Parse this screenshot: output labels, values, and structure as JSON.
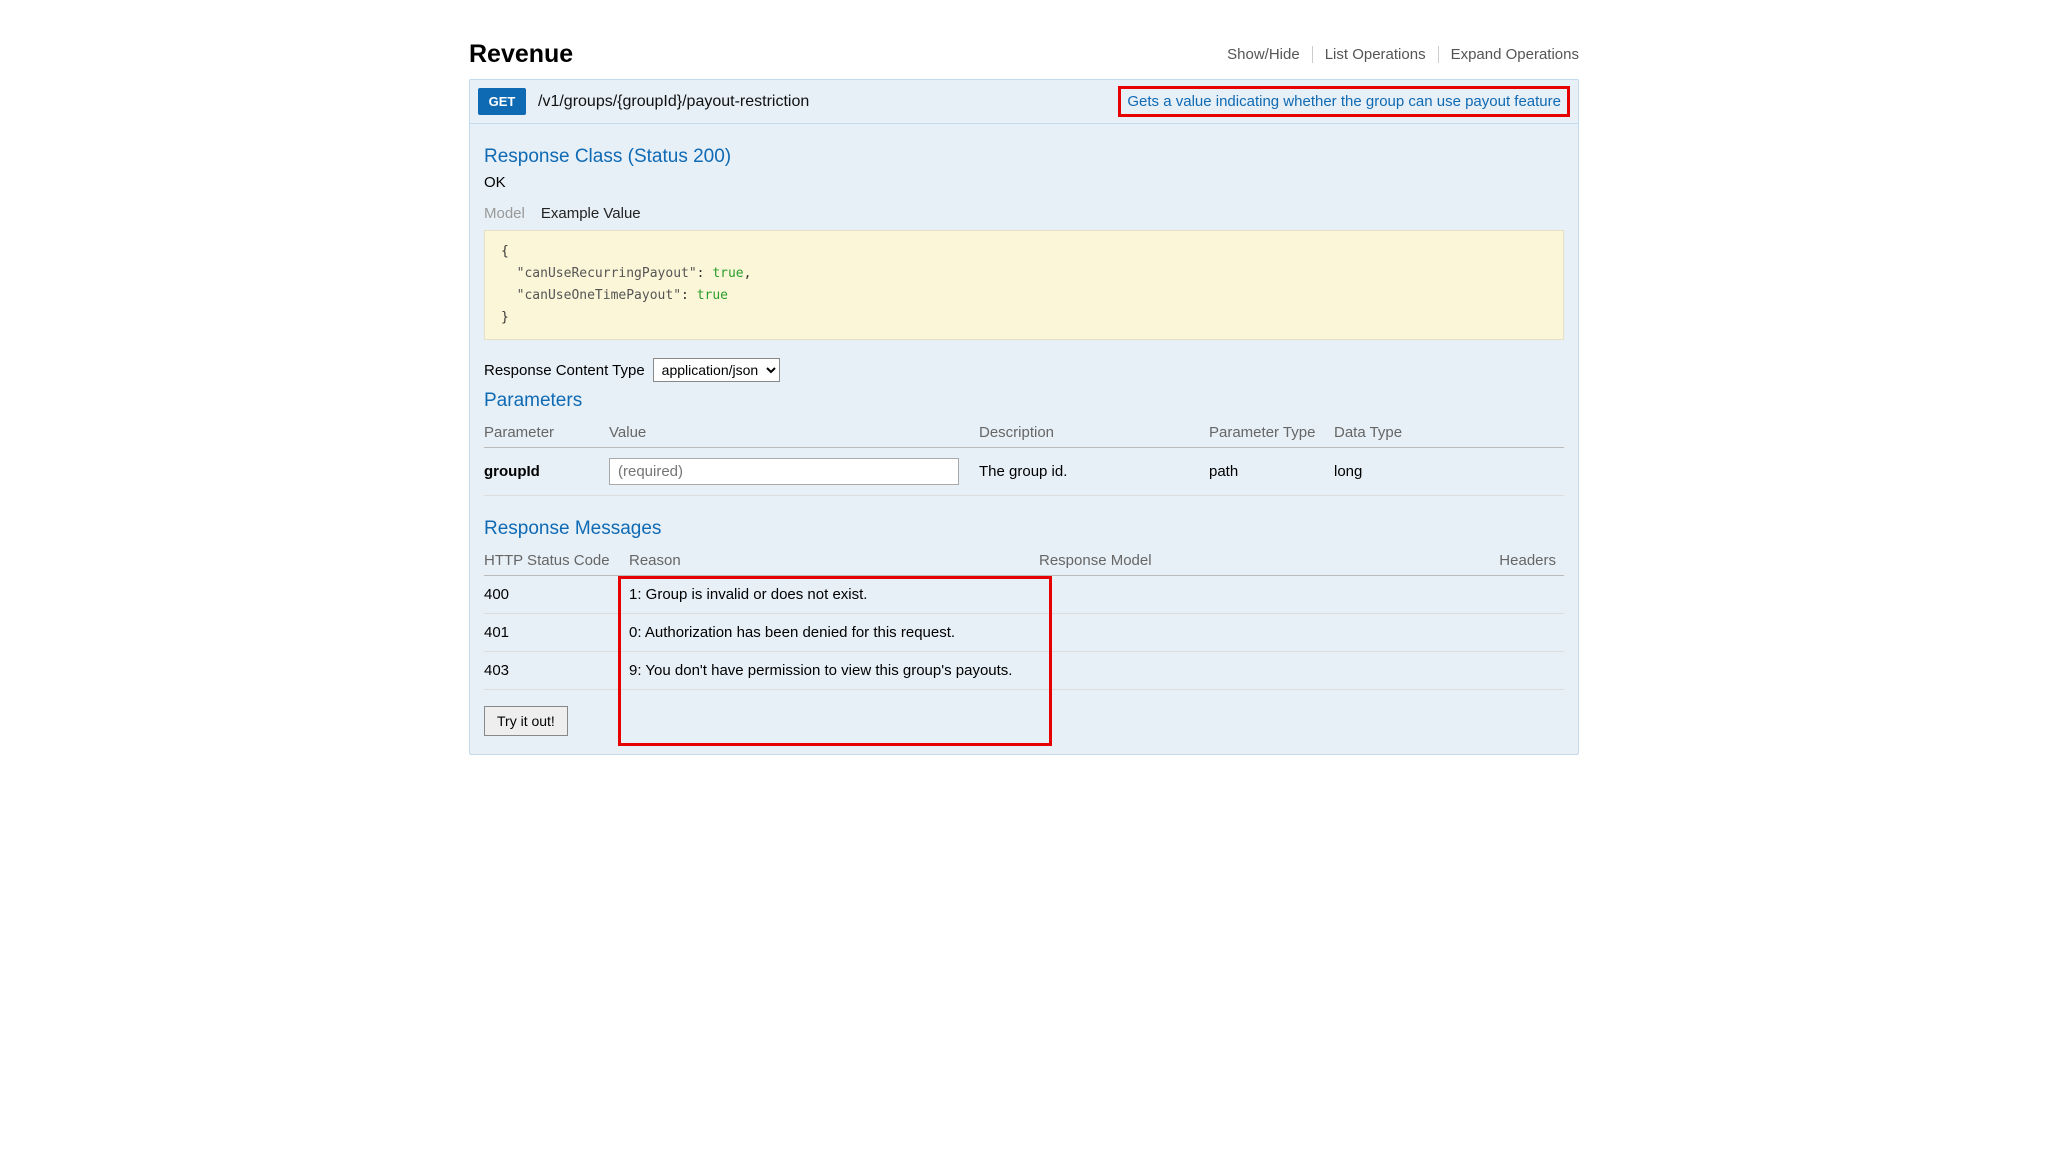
{
  "header": {
    "title": "Revenue",
    "links": [
      "Show/Hide",
      "List Operations",
      "Expand Operations"
    ]
  },
  "operation": {
    "method": "GET",
    "path": "/v1/groups/{groupId}/payout-restriction",
    "summary": "Gets a value indicating whether the group can use payout feature"
  },
  "response_class": {
    "heading": "Response Class (Status 200)",
    "ok": "OK",
    "tabs": {
      "model": "Model",
      "example": "Example Value"
    },
    "example_json": "{\n  \"canUseRecurringPayout\": true,\n  \"canUseOneTimePayout\": true\n}",
    "content_type_label": "Response Content Type",
    "content_type_value": "application/json"
  },
  "parameters": {
    "heading": "Parameters",
    "columns": [
      "Parameter",
      "Value",
      "Description",
      "Parameter Type",
      "Data Type"
    ],
    "rows": [
      {
        "name": "groupId",
        "placeholder": "(required)",
        "desc": "The group id.",
        "ptype": "path",
        "dtype": "long"
      }
    ]
  },
  "response_messages": {
    "heading": "Response Messages",
    "columns": [
      "HTTP Status Code",
      "Reason",
      "Response Model",
      "Headers"
    ],
    "rows": [
      {
        "code": "400",
        "reason": "1: Group is invalid or does not exist."
      },
      {
        "code": "401",
        "reason": "0: Authorization has been denied for this request."
      },
      {
        "code": "403",
        "reason": "9: You don't have permission to view this group's payouts."
      }
    ]
  },
  "try_label": "Try it out!"
}
